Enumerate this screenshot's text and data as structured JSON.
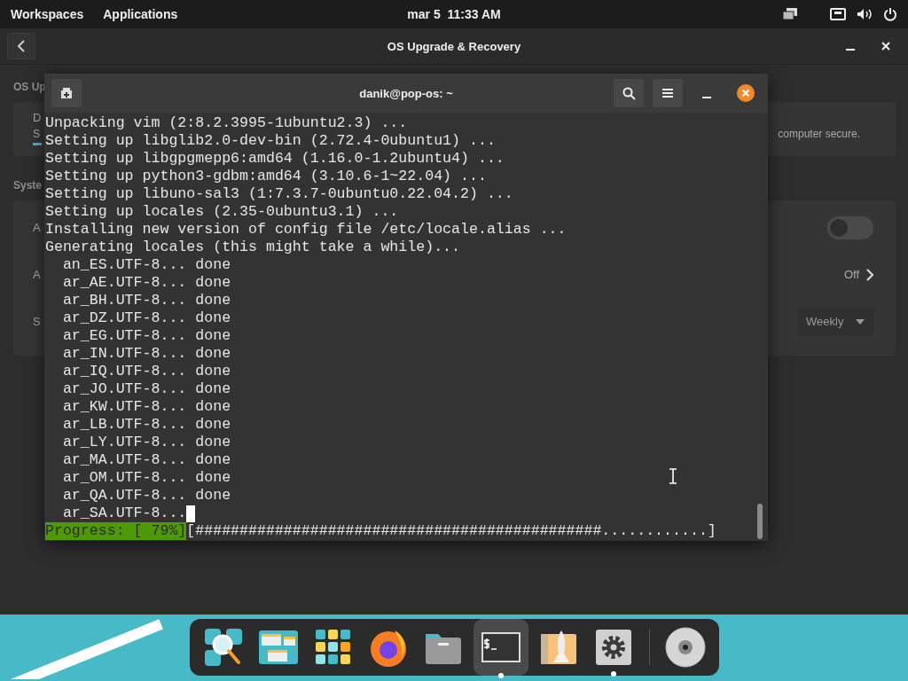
{
  "top_bar": {
    "menus": [
      "Workspaces",
      "Applications"
    ],
    "clock": "mar 5  11:33 AM"
  },
  "settings_window": {
    "title": "OS Upgrade & Recovery",
    "section_1": "OS Up",
    "card": {
      "line_1": "D",
      "line_2": "S",
      "note": "computer secure."
    },
    "section_2": "Syste",
    "rows": [
      {
        "kind": "toggle",
        "label": "A",
        "on": false
      },
      {
        "kind": "link",
        "label": "A",
        "value": "Off"
      },
      {
        "kind": "dropdown",
        "label": "S",
        "value": "Weekly"
      }
    ]
  },
  "terminal": {
    "title": "danik@pop-os: ~",
    "lines": [
      "Unpacking vim (2:8.2.3995-1ubuntu2.3) ...",
      "Setting up libglib2.0-dev-bin (2.72.4-0ubuntu1) ...",
      "Setting up libgpgmepp6:amd64 (1.16.0-1.2ubuntu4) ...",
      "Setting up python3-gdbm:amd64 (3.10.6-1~22.04) ...",
      "Setting up libuno-sal3 (1:7.3.7-0ubuntu0.22.04.2) ...",
      "Setting up locales (2.35-0ubuntu3.1) ...",
      "Installing new version of config file /etc/locale.alias ...",
      "Generating locales (this might take a while)...",
      "  an_ES.UTF-8... done",
      "  ar_AE.UTF-8... done",
      "  ar_BH.UTF-8... done",
      "  ar_DZ.UTF-8... done",
      "  ar_EG.UTF-8... done",
      "  ar_IN.UTF-8... done",
      "  ar_IQ.UTF-8... done",
      "  ar_JO.UTF-8... done",
      "  ar_KW.UTF-8... done",
      "  ar_LB.UTF-8... done",
      "  ar_LY.UTF-8... done",
      "  ar_MA.UTF-8... done",
      "  ar_OM.UTF-8... done",
      "  ar_QA.UTF-8... done",
      "  ar_SA.UTF-8..."
    ],
    "progress_label": "Progress: [ 79%]",
    "progress_bar": "[##############################################............]"
  },
  "dock": {
    "apps": [
      {
        "kind": "search",
        "selected": false,
        "running": false
      },
      {
        "kind": "windows",
        "selected": false,
        "running": false
      },
      {
        "kind": "grid",
        "selected": false,
        "running": false
      },
      {
        "kind": "browser",
        "selected": false,
        "running": false
      },
      {
        "kind": "files",
        "selected": false,
        "running": false
      },
      {
        "kind": "terminal",
        "selected": true,
        "running": true
      },
      {
        "kind": "shop",
        "selected": false,
        "running": false
      },
      {
        "kind": "settings",
        "selected": false,
        "running": true
      }
    ],
    "devices": [
      {
        "kind": "disc"
      }
    ]
  }
}
